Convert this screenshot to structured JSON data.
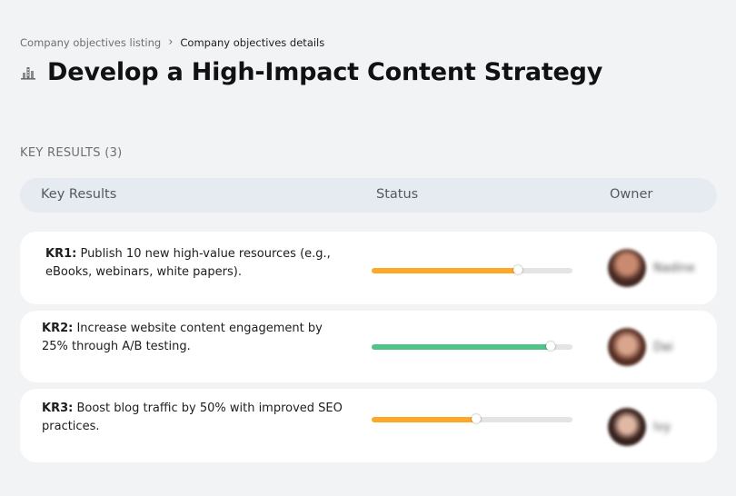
{
  "breadcrumb": {
    "parent": "Company objectives listing",
    "separator": "›",
    "current": "Company objectives details"
  },
  "page": {
    "title": "Develop a High-Impact Content Strategy",
    "title_icon": "chart-building-icon"
  },
  "key_results_label": "KEY RESULTS (3)",
  "table": {
    "columns": [
      "Key Results",
      "Status",
      "Owner"
    ]
  },
  "colors": {
    "in_progress": "#ffa726",
    "on_track": "#4fc486",
    "background": "#f2f3f5",
    "header_bg": "#e6eaf1"
  },
  "key_results": [
    {
      "code": "KR1:",
      "text": " Publish 10 new high-value resources (e.g., eBooks, webinars, white papers).",
      "progress": 0.73,
      "color": "#ffa726",
      "owner": "Nadine"
    },
    {
      "code": "KR2:",
      "text": " Increase website content engagement by 25% through A/B testing.",
      "progress": 0.89,
      "color": "#4fc486",
      "owner": "Dai"
    },
    {
      "code": "KR3:",
      "text": " Boost blog traffic by 50% with improved SEO practices.",
      "progress": 0.52,
      "color": "#ffa726",
      "owner": "Ivy"
    }
  ]
}
